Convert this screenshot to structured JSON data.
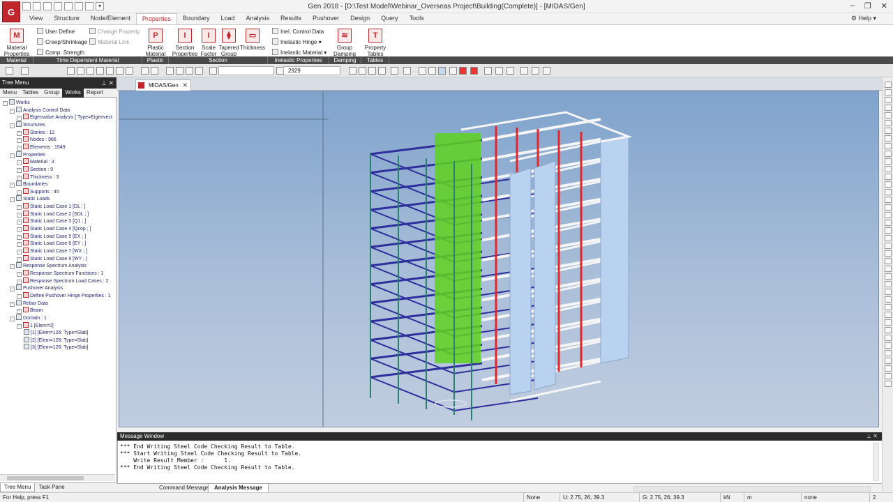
{
  "window": {
    "title": "Gen 2018 - [D:\\Test Model\\Webinar_Overseas Project\\Building(Complete)] - [MIDAS/Gen]",
    "logo": "G"
  },
  "menu": {
    "tabs": [
      "View",
      "Structure",
      "Node/Element",
      "Properties",
      "Boundary",
      "Load",
      "Analysis",
      "Results",
      "Pushover",
      "Design",
      "Query",
      "Tools"
    ],
    "active_tab": "Properties",
    "help": "Help"
  },
  "ribbon": {
    "material_properties": "Material Properties",
    "user_define": "User Define",
    "creep_shrinkage": "Creep/Shrinkage",
    "comp_strength": "Comp. Strength",
    "change_property": "Change Property",
    "material_link": "Material Link",
    "plastic_material": "Plastic Material",
    "section_properties": "Section Properties",
    "scale_factor": "Scale Factor",
    "tapered_group": "Tapered Group",
    "thickness": "Thickness",
    "inel_control_data": "Inel. Control Data",
    "inelastic_hinge": "Inelastic Hinge",
    "inelastic_material": "Inelastic Material",
    "group_damping": "Group Damping",
    "property_tables": "Property Tables",
    "groups": {
      "material": "Material",
      "time_dependent_material": "Time Dependent Material",
      "plastic": "Plastic",
      "section": "Section",
      "inelastic_properties": "Inelastic Properties",
      "damping": "Damping",
      "tables": "Tables"
    }
  },
  "toolbar": {
    "combo_value": "2929"
  },
  "tree": {
    "header": "Tree Menu",
    "tabs": [
      "Menu",
      "Tables",
      "Group",
      "Works",
      "Report"
    ],
    "active_tab": "Works",
    "bottom_tabs": [
      "Tree Menu",
      "Task Pane"
    ],
    "nodes": [
      {
        "label": "Works",
        "level": 0
      },
      {
        "label": "Analysis Control Data",
        "level": 1
      },
      {
        "label": "Eigenvalue Analysis [ Type=Eigenvect",
        "level": 2
      },
      {
        "label": "Structures",
        "level": 1
      },
      {
        "label": "Stories : 12",
        "level": 2
      },
      {
        "label": "Nodes : 966",
        "level": 2
      },
      {
        "label": "Elements : 1549",
        "level": 2
      },
      {
        "label": "Properties",
        "level": 1
      },
      {
        "label": "Material : 3",
        "level": 2
      },
      {
        "label": "Section : 9",
        "level": 2
      },
      {
        "label": "Thickness : 3",
        "level": 2
      },
      {
        "label": "Boundaries",
        "level": 1
      },
      {
        "label": "Supports : 45",
        "level": 2
      },
      {
        "label": "Static Loads",
        "level": 1
      },
      {
        "label": "Static Load Case 1 [DL ; ]",
        "level": 2
      },
      {
        "label": "Static Load Case 2 [SDL ; ]",
        "level": 2
      },
      {
        "label": "Static Load Case 3 [Q1 ; ]",
        "level": 2
      },
      {
        "label": "Static Load Case 4 [Qcop ; ]",
        "level": 2
      },
      {
        "label": "Static Load Case 5 [EX ; ]",
        "level": 2
      },
      {
        "label": "Static Load Case 6 [EY ; ]",
        "level": 2
      },
      {
        "label": "Static Load Case 7 [WX ; ]",
        "level": 2
      },
      {
        "label": "Static Load Case 8 [WY ; ]",
        "level": 2
      },
      {
        "label": "Response Spectrum Analysis",
        "level": 1
      },
      {
        "label": "Response Spectrum Functions : 1",
        "level": 2
      },
      {
        "label": "Response Spectrum Load Cases : 2",
        "level": 2
      },
      {
        "label": "Pushover Analysis",
        "level": 1
      },
      {
        "label": "Define Pushover Hinge Properties : 1",
        "level": 2
      },
      {
        "label": "Rebar Data",
        "level": 1
      },
      {
        "label": "Beam",
        "level": 2
      },
      {
        "label": "Domain : 1",
        "level": 1
      },
      {
        "label": "1 [Elem=0]",
        "level": 2
      },
      {
        "label": "[1] [Elem=126: Type=Slab]",
        "level": 3
      },
      {
        "label": "[2] [Elem=126: Type=Slab]",
        "level": 3
      },
      {
        "label": "[3] [Elem=126: Type=Slab]",
        "level": 3
      }
    ]
  },
  "document": {
    "tab_label": "MIDAS/Gen"
  },
  "message_window": {
    "title": "Message Window",
    "lines": [
      "*** End Writing Steel Code Checking Result to Table.",
      "*** Start Writing Steel Code Checking Result to Table.",
      "    Write Result Member :      1.",
      "*** End Writing Steel Code Checking Result to Table."
    ],
    "tabs": [
      "Command Message",
      "Analysis Message"
    ],
    "active_tab": "Analysis Message"
  },
  "status": {
    "help_text": "For Help, press F1",
    "selection": "None",
    "u_coords": "U: 2.75, 26, 39.3",
    "g_coords": "G: 2.75, 26, 39.3",
    "force_unit": "kN",
    "length_unit": "m",
    "none_filter": "none",
    "page_count": "2"
  },
  "colors": {
    "brand": "#c0262c",
    "beam_blue": "#2e2e9c",
    "column_red": "#e2262a",
    "wall_blue": "#b8d2f0",
    "core_green": "#5ed21e",
    "slab_white": "#f5f5f5"
  }
}
